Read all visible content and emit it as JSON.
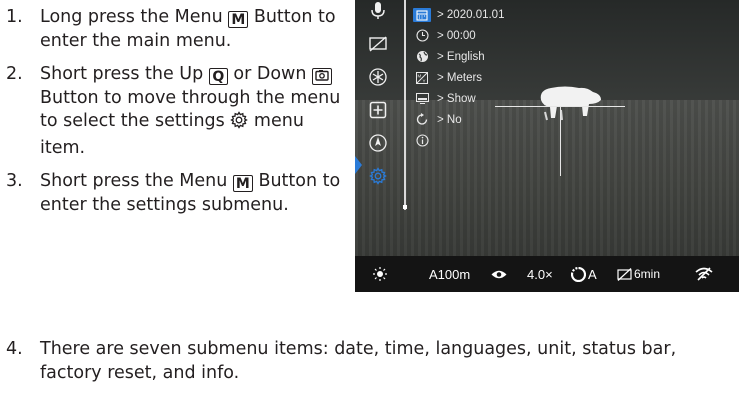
{
  "steps": [
    {
      "num": "1.",
      "part1": "Long press the Menu",
      "key": "M",
      "part2": "Button to enter the main menu."
    },
    {
      "num": "2.",
      "part1": "Short press the Up",
      "key_up": "Q",
      "part2": "or Down",
      "part3": "Button to move through the menu to select the settings",
      "part4": "menu item."
    },
    {
      "num": "3.",
      "part1": "Short press the Menu",
      "key": "M",
      "part2": "Button to enter the settings submenu."
    },
    {
      "num": "4.",
      "text": "There are seven submenu items: date, time, languages, unit, status bar, factory reset, and info."
    }
  ],
  "screen": {
    "left_icons": [
      "microphone-icon",
      "display-off-icon",
      "snowflake-icon",
      "plus-box-icon",
      "compass-icon",
      "settings-icon"
    ],
    "selected_icon": "settings-icon",
    "menu": [
      {
        "icon": "calendar-icon",
        "label": "> 2020.01.01",
        "selected": true
      },
      {
        "icon": "clock-icon",
        "label": "> 00:00"
      },
      {
        "icon": "globe-icon",
        "label": "> English"
      },
      {
        "icon": "unit-icon",
        "label": "> Meters"
      },
      {
        "icon": "status-bar-icon",
        "label": "> Show"
      },
      {
        "icon": "reset-icon",
        "label": "> No"
      },
      {
        "icon": "info-icon",
        "label": ""
      }
    ],
    "status": {
      "brightness_icon": "sun-icon",
      "mode": "A100m",
      "eye_icon": "eye-icon",
      "zoom": "4.0×",
      "palette": "A",
      "timer": "6min",
      "wifi_icon": "wifi-off-icon"
    },
    "accent": "#2a7bd8"
  }
}
